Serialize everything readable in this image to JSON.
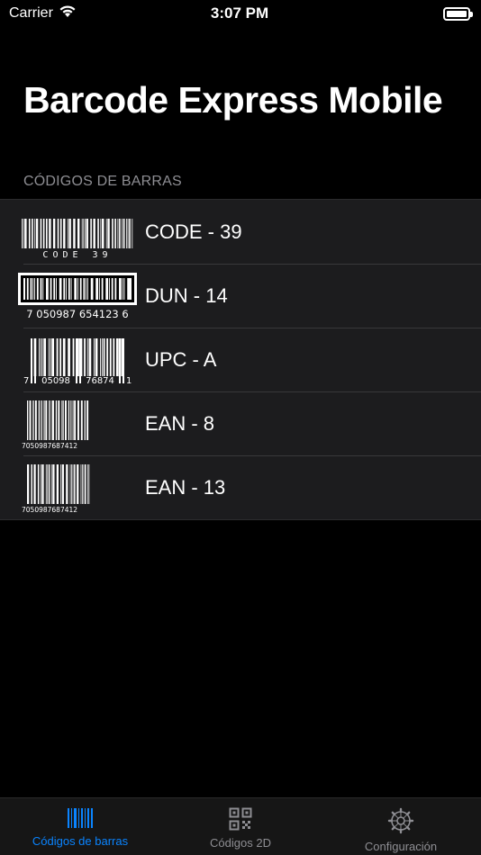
{
  "status_bar": {
    "carrier": "Carrier",
    "time": "3:07 PM",
    "battery_level": 1.0
  },
  "title": "Barcode Express Mobile",
  "section_header": "CÓDIGOS DE BARRAS",
  "barcodes": [
    {
      "label": "CODE - 39",
      "thumb_text": "CODE 39"
    },
    {
      "label": "DUN - 14",
      "thumb_text": "7 050987 654123 6"
    },
    {
      "label": "UPC - A",
      "thumb_text_left": "7",
      "thumb_text_mid1": "05098",
      "thumb_text_mid2": "76874",
      "thumb_text_right": "1"
    },
    {
      "label": "EAN - 8",
      "thumb_text": "7050987687412"
    },
    {
      "label": "EAN - 13",
      "thumb_text": "7050987687412"
    }
  ],
  "tabs": [
    {
      "label": "Códigos de barras",
      "icon": "barcode-icon",
      "active": true
    },
    {
      "label": "Códigos 2D",
      "icon": "qr-code-icon",
      "active": false
    },
    {
      "label": "Configuración",
      "icon": "gear-icon",
      "active": false
    }
  ],
  "colors": {
    "accent": "#0a84ff",
    "background": "#000000",
    "cell": "#1c1c1e",
    "secondary_text": "#8e8e93"
  }
}
